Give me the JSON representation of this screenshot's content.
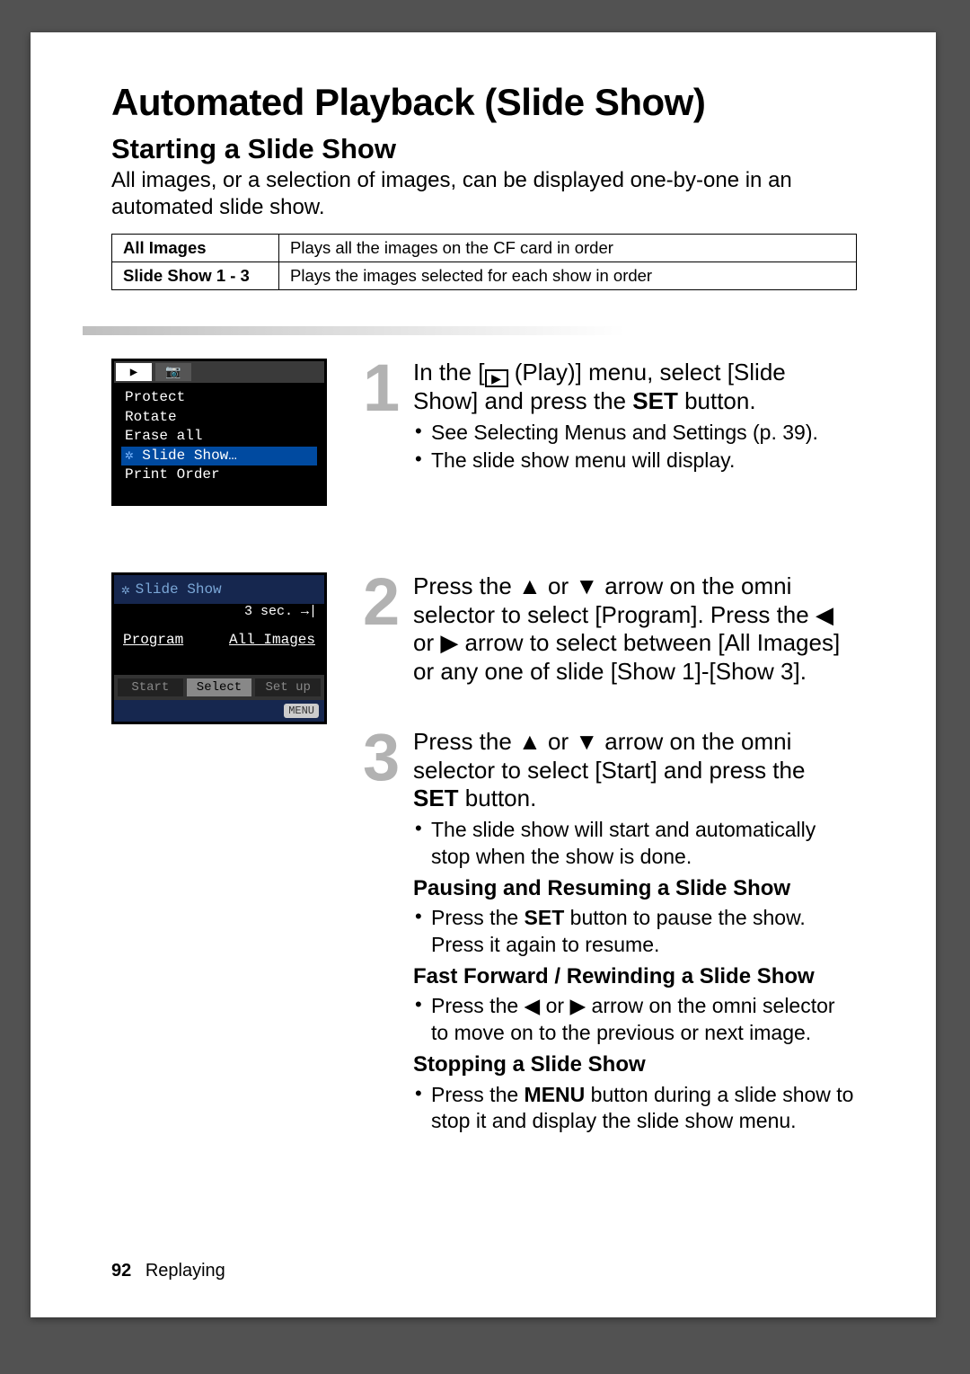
{
  "title": "Automated Playback (Slide Show)",
  "subtitle": "Starting a Slide Show",
  "intro": "All images, or a selection of images, can be displayed one-by-one in an automated slide show.",
  "table": {
    "rows": [
      {
        "k": "All Images",
        "v": "Plays all the images on the CF card in order"
      },
      {
        "k": "Slide Show 1 - 3",
        "v": "Plays the images selected for each show in order"
      }
    ]
  },
  "lcd1": {
    "items": [
      "Protect",
      "Rotate",
      "Erase all",
      "Slide Show…",
      "Print Order"
    ],
    "selected_index": 3
  },
  "lcd2": {
    "title": "Slide Show",
    "time": "3 sec.",
    "program_label": "Program",
    "program_value": "All Images",
    "buttons": [
      "Start",
      "Select",
      "Set up"
    ],
    "active_button_index": 1,
    "menu_label": "MENU"
  },
  "steps": {
    "s1": {
      "num": "1",
      "title_pre": "In the [",
      "title_mid": " (Play)] menu, select [Slide Show] and press the ",
      "title_btn": "SET",
      "title_post": " button.",
      "bullets": [
        "See Selecting Menus and Settings (p. 39).",
        "The slide show menu will display."
      ]
    },
    "s2": {
      "num": "2",
      "title": "Press the ▲ or ▼ arrow on the omni selector to select [Program]. Press the ◀ or ▶ arrow to select between [All Images] or any one of slide [Show 1]-[Show 3]."
    },
    "s3": {
      "num": "3",
      "title_pre": "Press the ▲ or ▼ arrow on the omni selector to select [Start] and press the ",
      "title_btn": "SET",
      "title_post": " button.",
      "bullets": [
        "The slide show will start and automatically stop when the show is done."
      ],
      "sub1_head": "Pausing and Resuming a Slide Show",
      "sub1_b_pre": "Press the ",
      "sub1_b_btn": "SET",
      "sub1_b_post": " button to pause the show. Press it again to resume.",
      "sub2_head": "Fast Forward / Rewinding a Slide Show",
      "sub2_b": "Press the ◀ or ▶ arrow on the omni selector to move on to the previous or next image.",
      "sub3_head": "Stopping a Slide Show",
      "sub3_b_pre": "Press the ",
      "sub3_b_btn": "MENU",
      "sub3_b_post": " button during a slide show to stop it and display the slide show menu."
    }
  },
  "footer": {
    "page": "92",
    "section": "Replaying"
  }
}
